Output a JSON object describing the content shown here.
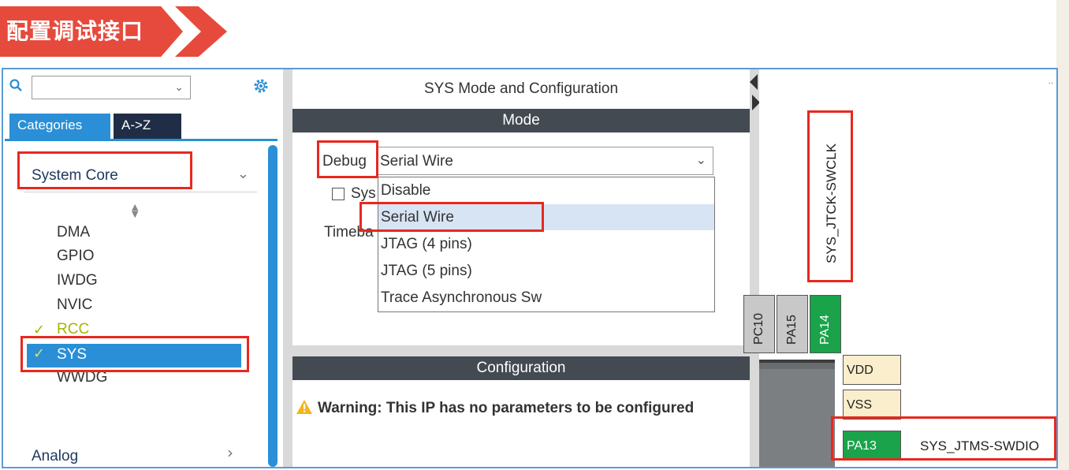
{
  "banner": {
    "title": "配置调试接口"
  },
  "left_panel": {
    "search": {
      "value": ""
    },
    "tabs": [
      {
        "label": "Categories"
      },
      {
        "label": "A->Z"
      }
    ],
    "category": {
      "label": "System Core"
    },
    "items": [
      {
        "label": "DMA",
        "checked": false
      },
      {
        "label": "GPIO",
        "checked": false
      },
      {
        "label": "IWDG",
        "checked": false
      },
      {
        "label": "NVIC",
        "checked": false
      },
      {
        "label": "RCC",
        "checked": true
      },
      {
        "label": "SYS",
        "checked": true,
        "selected": true
      },
      {
        "label": "WWDG",
        "checked": false
      }
    ],
    "next_category": {
      "label": "Analog"
    }
  },
  "middle_panel": {
    "title": "SYS Mode and Configuration",
    "mode_header": "Mode",
    "debug": {
      "label": "Debug",
      "value": "Serial Wire",
      "options": [
        {
          "label": "Disable"
        },
        {
          "label": "Serial Wire",
          "selected": true
        },
        {
          "label": "JTAG (4 pins)"
        },
        {
          "label": "JTAG (5 pins)"
        },
        {
          "label": "Trace Asynchronous Sw"
        }
      ]
    },
    "sys_wakeup_label": "Sys",
    "timebase_label": "Timeba",
    "configuration_header": "Configuration",
    "warning": "Warning: This IP has no parameters to be configured"
  },
  "chip_view": {
    "top_label": "SYS_JTCK-SWCLK",
    "top_pins": [
      {
        "label": "PC10"
      },
      {
        "label": "PA15"
      },
      {
        "label": "PA14"
      }
    ],
    "side_pins": [
      {
        "label": "VDD"
      },
      {
        "label": "VSS"
      },
      {
        "label": "PA13"
      }
    ],
    "side_label": "SYS_JTMS-SWDIO"
  },
  "colors": {
    "banner_red": "#e64a3c",
    "tab_blue": "#2a8fd6",
    "pin_green": "#1aa34a",
    "highlight_red": "#e8281e"
  }
}
